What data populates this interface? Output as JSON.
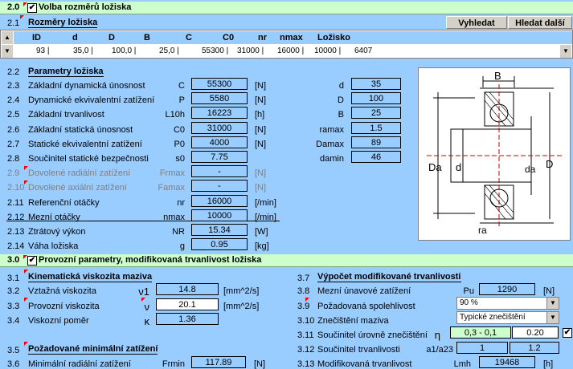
{
  "s20": {
    "num": "2.0",
    "title": "Volba rozměrů ložiska"
  },
  "s21": {
    "num": "2.1",
    "title": "Rozměry ložiska",
    "btn_search": "Vyhledat",
    "btn_search_next": "Hledat další"
  },
  "bearing_table": {
    "headers": [
      "ID",
      "d",
      "D",
      "B",
      "C",
      "C0",
      "nr",
      "nmax",
      "Ložisko"
    ],
    "row": [
      "93 |",
      "35,0 |",
      "100,0 |",
      "25,0 |",
      "55300 |",
      "31000 |",
      "16000 |",
      "10000 |",
      "6407"
    ]
  },
  "s22": {
    "num": "2.2",
    "title": "Parametry ložiska"
  },
  "params": [
    {
      "num": "2.3",
      "label": "Základní dynamická únosnost",
      "sym": "C",
      "val": "55300",
      "unit": "[N]"
    },
    {
      "num": "2.4",
      "label": "Dynamické ekvivalentní zatížení",
      "sym": "P",
      "val": "5580",
      "unit": "[N]"
    },
    {
      "num": "2.5",
      "label": "Základní trvanlivost",
      "sym": "L10h",
      "val": "16223",
      "unit": "[h]"
    },
    {
      "num": "2.6",
      "label": "Základní statická únosnost",
      "sym": "C0",
      "val": "31000",
      "unit": "[N]"
    },
    {
      "num": "2.7",
      "label": "Statické ekvivalentní zatížení",
      "sym": "P0",
      "val": "4000",
      "unit": "[N]"
    },
    {
      "num": "2.8",
      "label": "Součinitel statické bezpečnosti",
      "sym": "s0",
      "val": "7.75",
      "unit": ""
    },
    {
      "num": "2.9",
      "label": "Dovolené radiální zatížení",
      "sym": "Frmax",
      "val": "-",
      "unit": "[N]"
    },
    {
      "num": "2.10",
      "label": "Dovolené axiální zatížení",
      "sym": "Famax",
      "val": "-",
      "unit": "[N]"
    },
    {
      "num": "2.11",
      "label": "Referenční otáčky",
      "sym": "nr",
      "val": "16000",
      "unit": "[/min]"
    },
    {
      "num": "2.12",
      "label": "Mezní otáčky",
      "sym": "nmax",
      "val": "10000",
      "unit": "[/min]"
    },
    {
      "num": "2.13",
      "label": "Ztrátový výkon",
      "sym": "NR",
      "val": "15.34",
      "unit": "[W]"
    },
    {
      "num": "2.14",
      "label": "Váha ložiska",
      "sym": "g",
      "val": "0.95",
      "unit": "[kg]"
    }
  ],
  "dims": [
    {
      "sym": "d",
      "val": "35"
    },
    {
      "sym": "D",
      "val": "100"
    },
    {
      "sym": "B",
      "val": "25"
    },
    {
      "sym": "ramax",
      "val": "1.5"
    },
    {
      "sym": "Damax",
      "val": "89"
    },
    {
      "sym": "damin",
      "val": "46"
    }
  ],
  "drawing": {
    "B": "B",
    "Da": "Da",
    "d": "d",
    "da": "da",
    "D": "D",
    "ra": "ra"
  },
  "s30": {
    "num": "3.0",
    "title": "Provozní parametry, modifikovaná trvanlivost ložiska"
  },
  "s31": {
    "num": "3.1",
    "title": "Kinematická viskozita maziva"
  },
  "visc": [
    {
      "num": "3.2",
      "label": "Vztažná viskozita",
      "sym": "ν1",
      "val": "14.8",
      "unit": "[mm^2/s]"
    },
    {
      "num": "3.3",
      "label": "Provozní viskozita",
      "sym": "ν",
      "val": "20.1",
      "unit": "[mm^2/s]"
    },
    {
      "num": "3.4",
      "label": "Viskozní poměr",
      "sym": "κ",
      "val": "1.36",
      "unit": ""
    }
  ],
  "s35": {
    "num": "3.5",
    "title": "Požadované minimální zatížení"
  },
  "minload": {
    "num": "3.6",
    "label": "Minimální radiální zatížení",
    "sym": "Frmin",
    "val": "117.89",
    "unit": "[N]"
  },
  "s37": {
    "num": "3.7",
    "title": "Výpočet modifikované trvanlivosti"
  },
  "mod": {
    "r38": {
      "num": "3.8",
      "label": "Mezní únavové zatížení",
      "sym": "Pu",
      "val": "1290",
      "unit": "[N]"
    },
    "r39": {
      "num": "3.9",
      "label": "Požadovaná spolehlivost",
      "select": "90 %"
    },
    "r310": {
      "num": "3.10",
      "label": "Znečištění maziva",
      "select": "Typické znečištění"
    },
    "r311": {
      "num": "3.11",
      "label": "Součinitel úrovně znečištění",
      "sym": "η",
      "range": "0,3 - 0,1",
      "val": "0.20"
    },
    "r312": {
      "num": "3.12",
      "label": "Součinitel trvanlivosti",
      "sym": "a1/a23",
      "val1": "1",
      "val2": "1.2"
    },
    "r313": {
      "num": "3.13",
      "label": "Modifikovaná trvanlivost",
      "sym": "Lmh",
      "val": "19468",
      "unit": "[h]"
    }
  }
}
